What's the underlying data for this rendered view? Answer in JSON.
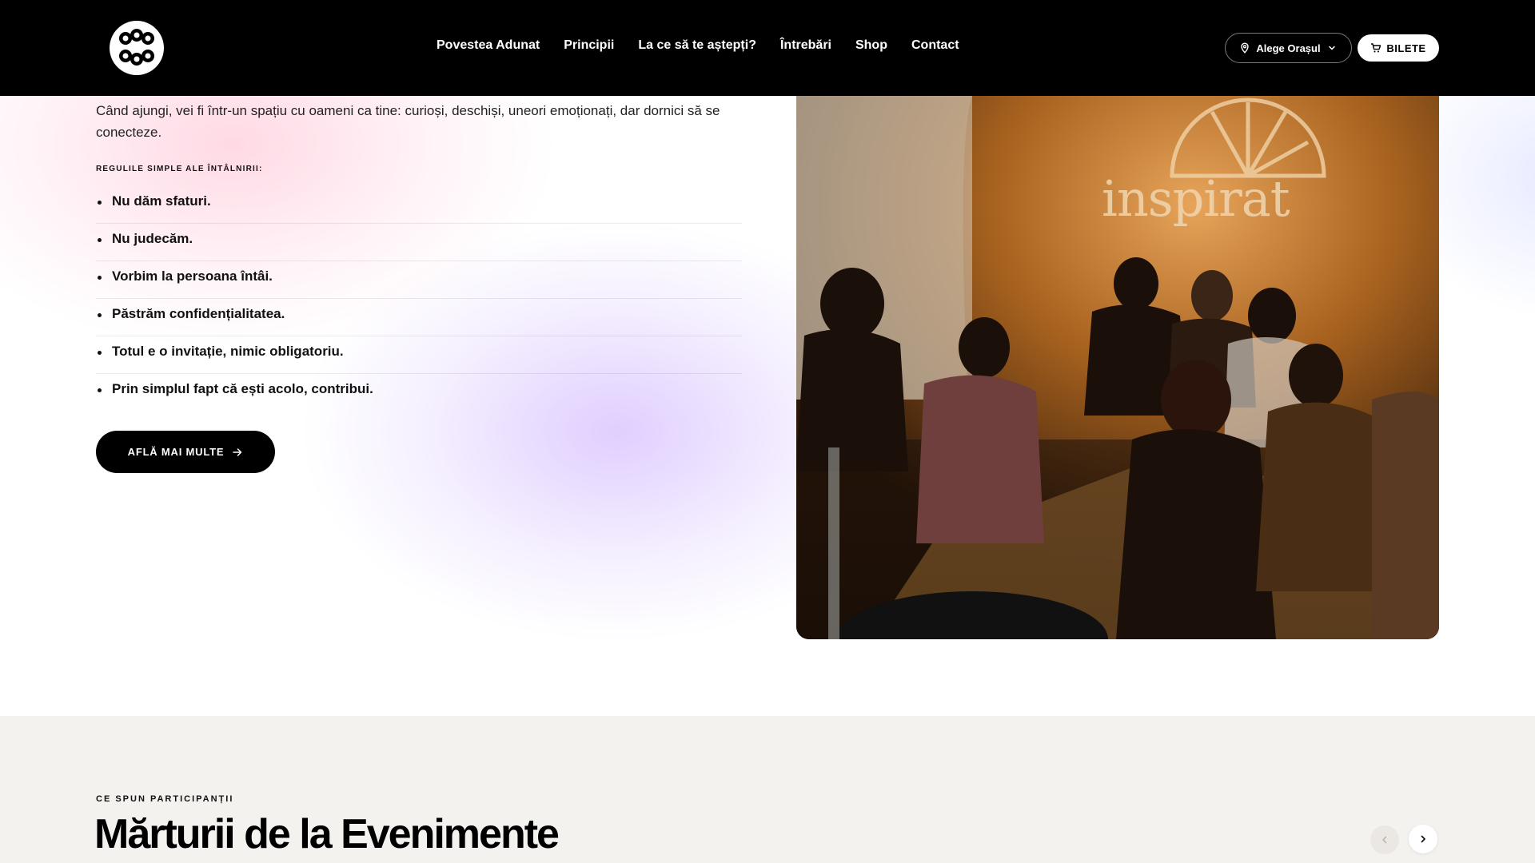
{
  "header": {
    "nav": [
      {
        "label": "Povestea Adunat"
      },
      {
        "label": "Principii"
      },
      {
        "label": "La ce să te aștepți?"
      },
      {
        "label": "Întrebări"
      },
      {
        "label": "Shop"
      },
      {
        "label": "Contact"
      }
    ],
    "city_label": "Alege Orașul",
    "tickets_label": "BILETE"
  },
  "hero": {
    "intro": "Când ajungi, vei fi într-un spațiu cu oameni ca tine: curioși, deschiși, uneori emoționați, dar dornici să se conecteze.",
    "rules_label": "REGULILE SIMPLE ALE ÎNTÂLNIRII:",
    "rules": [
      "Nu dăm sfaturi.",
      "Nu judecăm.",
      "Vorbim la persoana întâi.",
      "Păstrăm confidențialitatea.",
      "Totul e o invitație, nimic obligatoriu.",
      "Prin simplul fapt că ești acolo, contribui."
    ],
    "cta_label": "AFLĂ MAI MULTE",
    "photo_sign": "inspirat"
  },
  "testimonials": {
    "eyebrow": "CE SPUN PARTICIPANȚII",
    "title": "Mărturii de la Evenimente"
  },
  "icons": {
    "logo": "adunat-logo",
    "city": "location-pin-icon",
    "city_dropdown": "chevron-down-icon",
    "tickets": "cart-icon",
    "cta": "arrow-right-icon",
    "prev": "chevron-left-icon",
    "next": "chevron-right-icon"
  }
}
